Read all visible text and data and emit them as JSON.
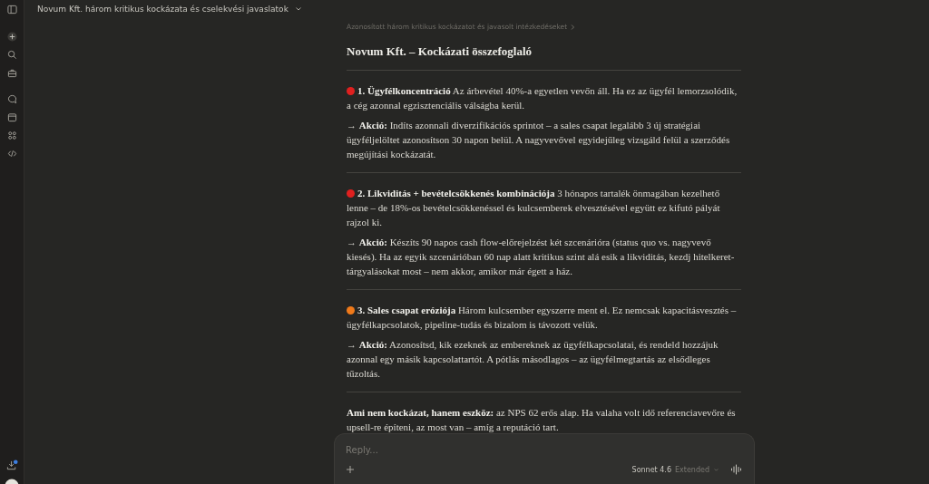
{
  "header": {
    "title": "Novum Kft. három kritikus kockázata és cselekvési javaslatok"
  },
  "message": {
    "breadcrumb": "Azonosított három kritikus kockázatot és javasolt intézkedéseket",
    "heading": "Novum Kft. – Kockázati összefoglaló",
    "sections": [
      {
        "kind": "risk",
        "color": "#e0201f",
        "text": "**1. Ügyfélkoncentráció** Az árbevétel 40%-a egyetlen vevőn áll. Ha ez az ügyfél lemorzsolódik, a cég azonnal egzisztenciális válságba kerül.",
        "action": "→ **Akció:** Indíts azonnali diverzifikációs sprintot – a sales csapat legalább 3 új stratégiai ügyféljelöltet azonosítson 30 napon belül. A nagyvevővel egyidejűleg vizsgáld felül a szerződés megújítási kockázatát."
      },
      {
        "kind": "risk",
        "color": "#e0201f",
        "text": "**2. Likviditás + bevételcsökkenés kombinációja** 3 hónapos tartalék önmagában kezelhető lenne – de 18%-os bevételcsökkenéssel és kulcsemberek elvesztésével együtt ez kifutó pályát rajzol ki.",
        "action": "→ **Akció:** Készíts 90 napos cash flow-előrejelzést két szcenárióra (status quo vs. nagyvevő kiesés). Ha az egyik szcenárióban 60 nap alatt kritikus szint alá esik a likviditás, kezdj hitelkeret-tárgyalásokat most – nem akkor, amikor már égett a ház."
      },
      {
        "kind": "risk",
        "color": "#f07a1a",
        "text": "**3. Sales csapat eróziója** Három kulcsember egyszerre ment el. Ez nemcsak kapacitásvesztés – ügyfélkapcsolatok, pipeline-tudás és bizalom is távozott velük.",
        "action": "→ **Akció:** Azonosítsd, kik ezeknek az embereknek az ügyfélkapcsolatai, és rendeld hozzájuk azonnal egy másik kapcsolattartót. A pótlás másodlagos – az ügyfélmegtartás az elsődleges tűzoltás."
      },
      {
        "kind": "note",
        "text": "**Ami nem kockázat, hanem eszköz:** az NPS 62 erős alap. Ha valaha volt idő referenciavevőre és upsell-re építeni, az most van – amíg a reputáció tart."
      }
    ]
  },
  "composer": {
    "placeholder": "Reply...",
    "model": "Sonnet 4.6",
    "mode": "Extended"
  }
}
